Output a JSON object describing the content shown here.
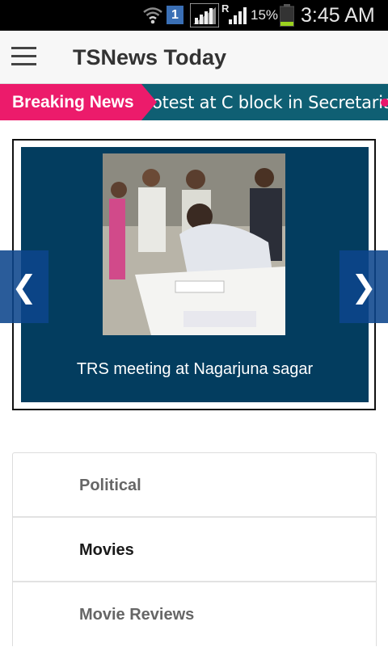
{
  "status_bar": {
    "sim_slot": "1",
    "roaming": "R",
    "battery_percent": "15%",
    "time": "3:45 AM",
    "battery_level": 0.15,
    "icons": [
      "wifi-icon",
      "sim-icon",
      "signal-icon",
      "signal-roaming-icon",
      "battery-icon"
    ]
  },
  "app_bar": {
    "title": "TSNews Today",
    "menu_icon": "hamburger-menu-icon"
  },
  "breaking_news": {
    "label": "Breaking News",
    "ticker_text": "otest at C block in Secretariat",
    "colors": {
      "label_bg": "#ec1b6b",
      "bar_bg": "#0f5f73"
    }
  },
  "slider": {
    "caption": "TRS meeting at Nagarjuna sagar",
    "prev_glyph": "❮",
    "next_glyph": "❯",
    "colors": {
      "slide_bg": "#033d5f",
      "arrow_bg": "#0c468c"
    }
  },
  "categories": [
    {
      "label": "Political",
      "state": "muted"
    },
    {
      "label": "Movies",
      "state": "active"
    },
    {
      "label": "Movie Reviews",
      "state": "muted"
    }
  ]
}
